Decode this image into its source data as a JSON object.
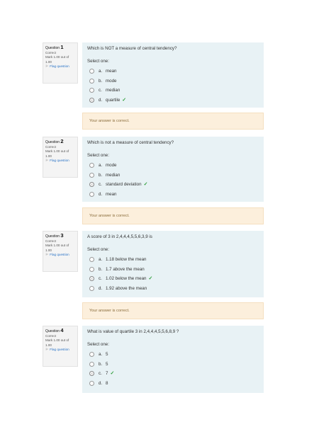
{
  "questions": [
    {
      "number_prefix": "Question",
      "number": "1",
      "state": "Correct",
      "mark": "Mark 1.00 out of 1.00",
      "flag_label": "Flag question",
      "text": "Which is NOT a measure of central tendency?",
      "select_prompt": "Select one:",
      "answers": [
        {
          "letter": "a.",
          "text": "mean"
        },
        {
          "letter": "b.",
          "text": "mode"
        },
        {
          "letter": "c.",
          "text": "median"
        },
        {
          "letter": "d.",
          "text": "quartile"
        }
      ],
      "selected_index": 3,
      "feedback": "Your answer is correct."
    },
    {
      "number_prefix": "Question",
      "number": "2",
      "state": "Correct",
      "mark": "Mark 1.00 out of 1.00",
      "flag_label": "Flag question",
      "text": "Which is not a measure of central tendency?",
      "select_prompt": "Select one:",
      "answers": [
        {
          "letter": "a.",
          "text": "mode"
        },
        {
          "letter": "b.",
          "text": "median"
        },
        {
          "letter": "c.",
          "text": "standard deviation"
        },
        {
          "letter": "d.",
          "text": "mean"
        }
      ],
      "selected_index": 2,
      "feedback": "Your answer is correct."
    },
    {
      "number_prefix": "Question",
      "number": "3",
      "state": "Correct",
      "mark": "Mark 1.00 out of 1.00",
      "flag_label": "Flag question",
      "text": "A score of 3 in 2,4,4,4,5,5,6,3,9 is",
      "select_prompt": "Select one:",
      "answers": [
        {
          "letter": "a.",
          "text": "1.18 below the mean"
        },
        {
          "letter": "b.",
          "text": "1.7 above the mean"
        },
        {
          "letter": "c.",
          "text": "1.02 below the mean"
        },
        {
          "letter": "d.",
          "text": "1.92 above the mean"
        }
      ],
      "selected_index": 2,
      "feedback": "Your answer is correct."
    },
    {
      "number_prefix": "Question",
      "number": "4",
      "state": "Correct",
      "mark": "Mark 1.00 out of 1.00",
      "flag_label": "Flag question",
      "text": "What is value of quartile 3 in 2,4,4,4,5,5,6,8,9 ?",
      "select_prompt": "Select one:",
      "answers": [
        {
          "letter": "a.",
          "text": "5"
        },
        {
          "letter": "b.",
          "text": "5"
        },
        {
          "letter": "c.",
          "text": "7"
        },
        {
          "letter": "d.",
          "text": "8"
        }
      ],
      "selected_index": 2,
      "feedback": null
    }
  ],
  "colors": {
    "content_bg": "#e8f2f5",
    "feedback_bg": "#fcefdc",
    "check": "#2e9e3a",
    "link": "#2a73c6"
  },
  "icons": {
    "flag": "flag-icon",
    "correct": "checkmark-icon",
    "radio": "radio-button"
  }
}
